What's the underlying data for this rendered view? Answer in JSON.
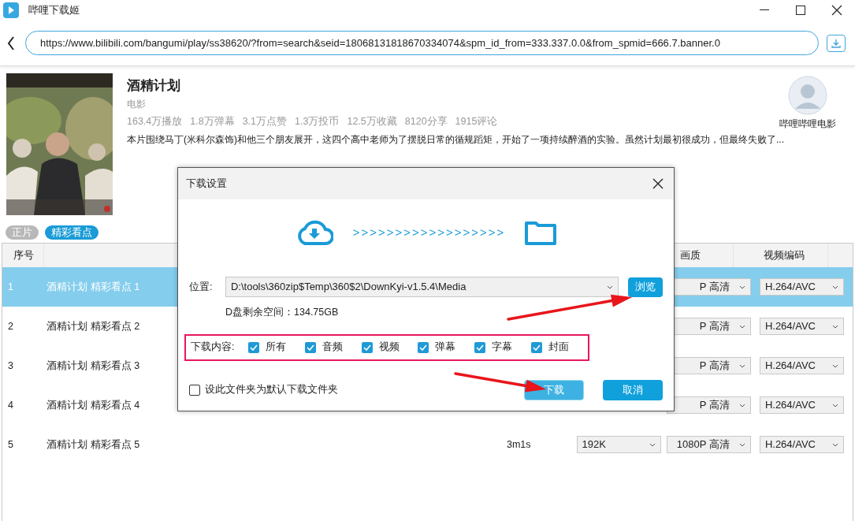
{
  "window": {
    "title": "哔哩下载姬"
  },
  "address_bar": {
    "value": "https://www.bilibili.com/bangumi/play/ss38620/?from=search&seid=18068131818670334074&spm_id_from=333.337.0.0&from_spmid=666.7.banner.0"
  },
  "media": {
    "title": "酒精计划",
    "type": "电影",
    "stats": [
      "163.4万播放",
      "1.8万弹幕",
      "3.1万点赞",
      "1.3万投币",
      "12.5万收藏",
      "8120分享",
      "1915评论"
    ],
    "description": "本片围绕马丁(米科尔森饰)和他三个朋友展开，这四个高中老师为了摆脱日常的循规蹈矩，开始了一项持续醉酒的实验。虽然计划最初很成功，但最终失败了...",
    "uploader": "哔哩哔哩电影"
  },
  "tabs": [
    {
      "label": "正片",
      "selected": false
    },
    {
      "label": "精彩看点",
      "selected": true
    }
  ],
  "table": {
    "columns": [
      "序号",
      "画质",
      "视频编码"
    ],
    "rows": [
      {
        "index": "1",
        "name": "酒精计划 精彩看点 1",
        "quality": "P 高清",
        "codec": "H.264/AVC",
        "selected": true
      },
      {
        "index": "2",
        "name": "酒精计划 精彩看点 2",
        "quality": "P 高清",
        "codec": "H.264/AVC",
        "selected": false
      },
      {
        "index": "3",
        "name": "酒精计划 精彩看点 3",
        "quality": "P 高清",
        "codec": "H.264/AVC",
        "selected": false
      },
      {
        "index": "4",
        "name": "酒精计划 精彩看点 4",
        "quality": "P 高清",
        "codec": "H.264/AVC",
        "selected": false
      },
      {
        "index": "5",
        "name": "酒精计划 精彩看点 5",
        "duration": "3m1s",
        "audio": "192K",
        "quality": "1080P 高清",
        "codec": "H.264/AVC",
        "selected": false
      }
    ]
  },
  "dialog": {
    "title": "下载设置",
    "progress_arrows": ">>>>>>>>>>>>>>>>>>",
    "location_label": "位置:",
    "location": "D:\\tools\\360zip$Temp\\360$2\\DownKyi-v1.5.4\\Media",
    "browse": "浏览",
    "free_space": "D盘剩余空间：134.75GB",
    "content_label": "下载内容:",
    "content_options": [
      {
        "label": "所有",
        "checked": true
      },
      {
        "label": "音频",
        "checked": true
      },
      {
        "label": "视频",
        "checked": true
      },
      {
        "label": "弹幕",
        "checked": true
      },
      {
        "label": "字幕",
        "checked": true
      },
      {
        "label": "封面",
        "checked": true
      }
    ],
    "default_folder": {
      "label": "设此文件夹为默认下载文件夹",
      "checked": false
    },
    "buttons": [
      {
        "label": "下载",
        "kind": "primary-hover"
      },
      {
        "label": "取消",
        "kind": "primary"
      }
    ]
  }
}
